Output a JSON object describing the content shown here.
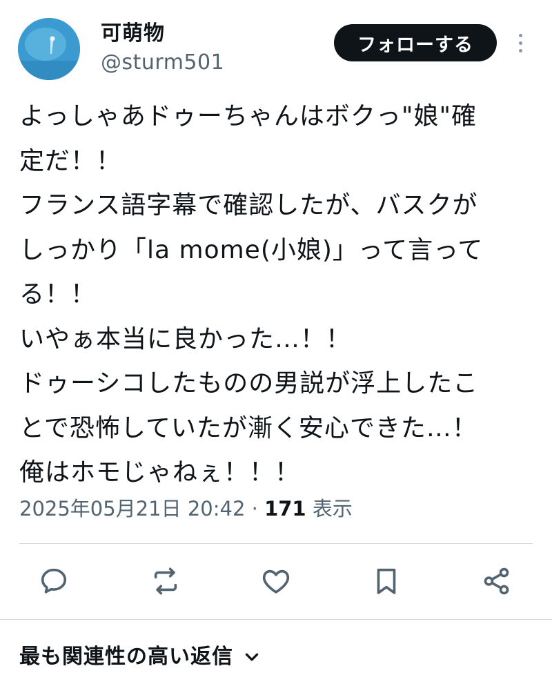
{
  "author": {
    "display_name": "可萌物",
    "handle": "@sturm501"
  },
  "follow_button": {
    "label": "フォローする"
  },
  "more_button": {
    "icon": "more-vertical-icon"
  },
  "tweet": {
    "lines": [
      "よっしゃあドゥーちゃんはボクっ\"娘\"確",
      "定だ！！",
      "フランス語字幕で確認したが、バスクが",
      "しっかり「la mome(小娘)」って言って",
      "る！！",
      "いやぁ本当に良かった…！！",
      "ドゥーシコしたものの男説が浮上したこ",
      "とで恐怖していたが漸く安心できた…！",
      "俺はホモじゃねぇ！！！"
    ]
  },
  "meta": {
    "timestamp": "2025年05月21日 20:42",
    "separator": " · ",
    "views_count": "171",
    "views_label": " 表示"
  },
  "actions": [
    {
      "name": "reply",
      "icon": "reply-icon"
    },
    {
      "name": "repost",
      "icon": "repost-icon"
    },
    {
      "name": "like",
      "icon": "heart-icon"
    },
    {
      "name": "bookmark",
      "icon": "bookmark-icon"
    },
    {
      "name": "share",
      "icon": "share-icon"
    }
  ],
  "replies_sort": {
    "label": "最も関連性の高い返信",
    "icon": "chevron-down-icon"
  },
  "colors": {
    "text_primary": "#0f1419",
    "text_secondary": "#536471",
    "divider": "#cfd9de",
    "button_bg": "#0f1419"
  }
}
